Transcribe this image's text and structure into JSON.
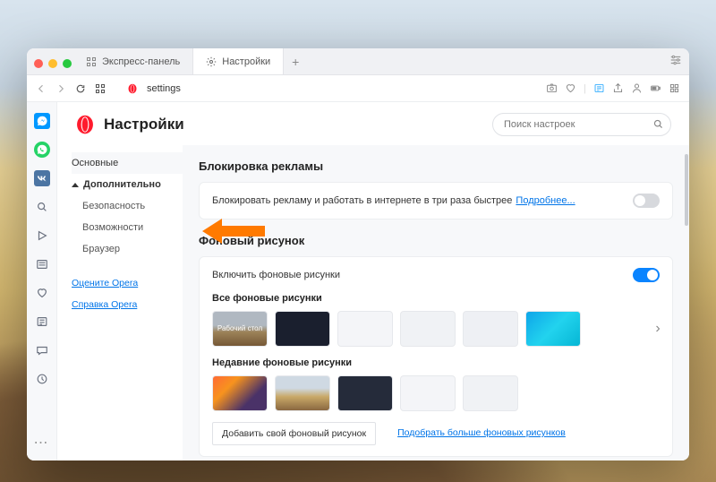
{
  "tabs": {
    "express": "Экспресс-панель",
    "settings": "Настройки"
  },
  "address": "settings",
  "page": {
    "title": "Настройки",
    "search_placeholder": "Поиск настроек"
  },
  "sidebar": {
    "main": "Основные",
    "advanced": "Дополнительно",
    "security": "Безопасность",
    "features": "Возможности",
    "browser": "Браузер",
    "rate": "Оцените Opera",
    "help": "Справка Opera"
  },
  "sections": {
    "adblock": {
      "title": "Блокировка рекламы",
      "text": "Блокировать рекламу и работать в интернете в три раза быстрее",
      "more": "Подробнее..."
    },
    "wallpaper": {
      "title": "Фоновый рисунок",
      "enable": "Включить фоновые рисунки",
      "all": "Все фоновые рисунки",
      "desk_label": "Рабочий стол",
      "recent": "Недавние фоновые рисунки",
      "add": "Добавить свой фоновый рисунок",
      "pick_more": "Подобрать больше фоновых рисунков"
    }
  }
}
